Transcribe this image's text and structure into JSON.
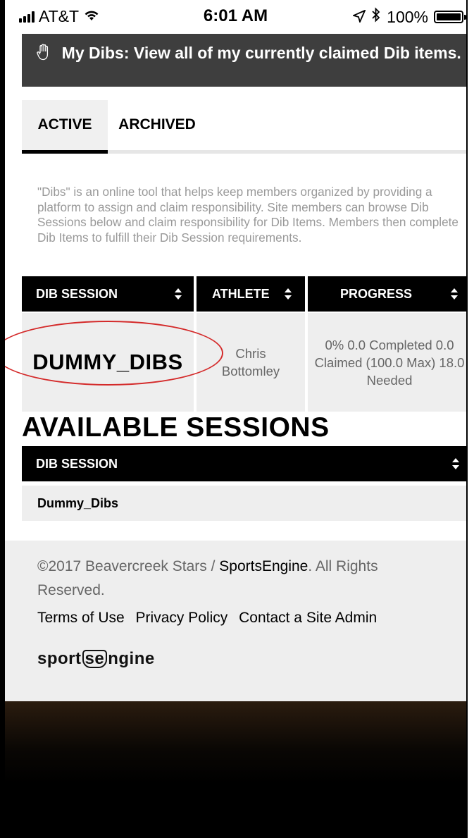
{
  "status_bar": {
    "carrier": "AT&T",
    "time": "6:01 AM",
    "battery": "100%",
    "battery_level": 1.0
  },
  "banner": {
    "title": "My Dibs: View all of my currently claimed Dib items."
  },
  "tabs": [
    {
      "label": "ACTIVE",
      "selected": true
    },
    {
      "label": "ARCHIVED",
      "selected": false
    }
  ],
  "description": "\"Dibs\" is an online tool that helps keep members organized by providing a platform to assign and claim responsibility. Site members can browse Dib Sessions below and claim responsibility for Dib Items. Members then complete Dib Items to fulfill their Dib Session requirements.",
  "my_dibs_table": {
    "headers": [
      "DIB SESSION",
      "ATHLETE",
      "PROGRESS"
    ],
    "rows": [
      {
        "session": "DUMMY_DIBS",
        "athlete": "Chris Bottomley",
        "progress": "0% 0.0 Completed 0.0 Claimed (100.0 Max) 18.0 Needed"
      }
    ]
  },
  "available_sessions": {
    "title": "AVAILABLE SESSIONS",
    "header": "DIB SESSION",
    "rows": [
      "Dummy_Dibs"
    ]
  },
  "footer": {
    "copyright_prefix": "©2017 Beavercreek Stars / ",
    "brand": "SportsEngine",
    "copyright_suffix": ". All Rights Reserved.",
    "links": [
      "Terms of Use",
      "Privacy Policy",
      "Contact a Site Admin"
    ],
    "logo_left": "sport",
    "logo_mid": "se",
    "logo_right": "ngine"
  },
  "colors": {
    "banner_bg": "#3e3e3e",
    "header_bg": "#000000",
    "cell_bg": "#eeeeee",
    "annotation": "#d42a2a"
  }
}
